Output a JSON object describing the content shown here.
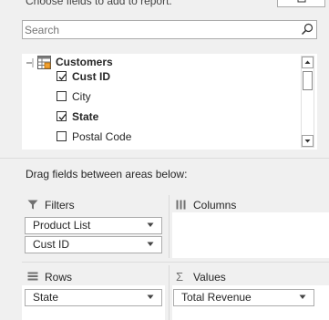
{
  "header": {
    "choose_fields_text": "Choose fields to add to report:",
    "gear_button_icon": "gear-icon"
  },
  "search": {
    "placeholder": "Search",
    "value": "",
    "icon": "search-icon"
  },
  "field_list": {
    "table_name": "Customers",
    "table_icon": "table-icon",
    "fields": [
      {
        "label": "Cust ID",
        "checked": true,
        "bold": true
      },
      {
        "label": "City",
        "checked": false,
        "bold": false
      },
      {
        "label": "State",
        "checked": true,
        "bold": true
      },
      {
        "label": "Postal Code",
        "checked": false,
        "bold": false
      }
    ]
  },
  "areas": {
    "instructions": "Drag fields between areas below:",
    "filters": {
      "label": "Filters",
      "icon": "filter-icon",
      "items": [
        "Product List",
        "Cust ID"
      ]
    },
    "columns": {
      "label": "Columns",
      "icon": "columns-icon",
      "items": []
    },
    "rows": {
      "label": "Rows",
      "icon": "rows-icon",
      "items": [
        "State"
      ]
    },
    "values": {
      "label": "Values",
      "icon": "sigma-icon",
      "items": [
        "Total Revenue"
      ]
    }
  }
}
